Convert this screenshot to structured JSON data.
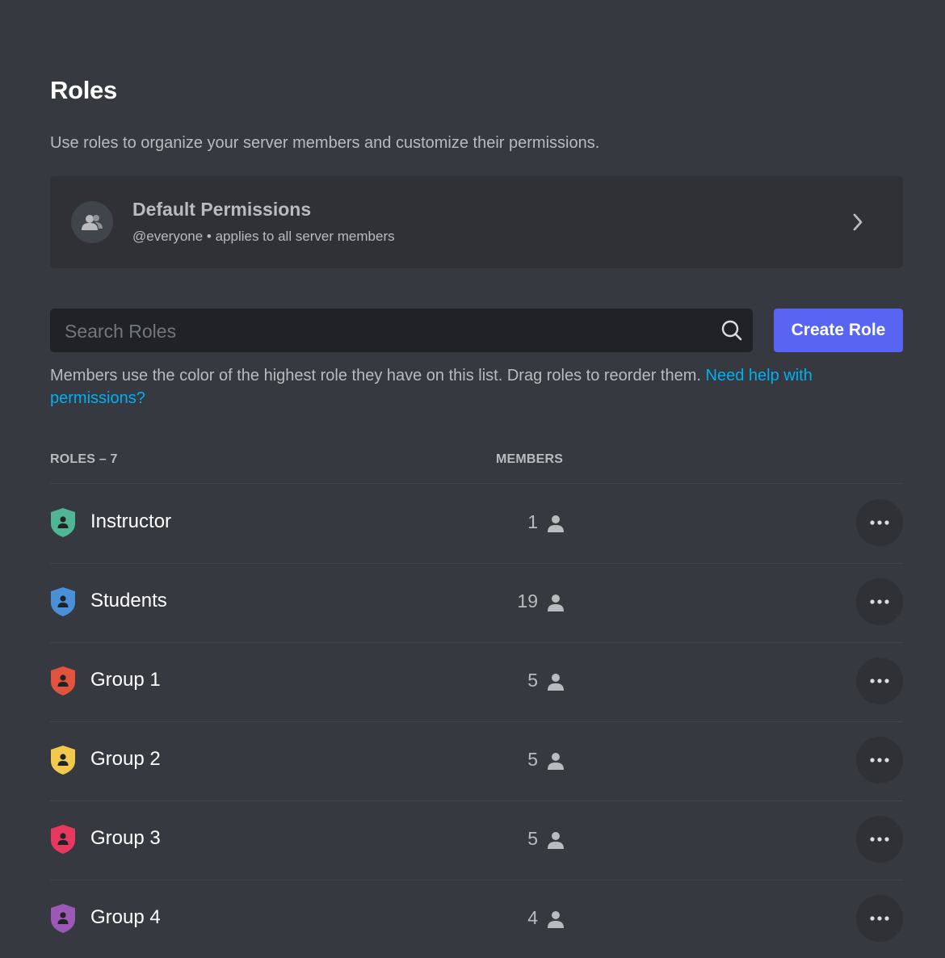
{
  "header": {
    "title": "Roles",
    "subtitle": "Use roles to organize your server members and customize their permissions."
  },
  "default_permissions": {
    "title": "Default Permissions",
    "subtitle": "@everyone • applies to all server members",
    "icon": "members-icon"
  },
  "search": {
    "placeholder": "Search Roles",
    "value": ""
  },
  "create_button": {
    "label": "Create Role",
    "color": "#5865f2"
  },
  "help": {
    "text": "Members use the color of the highest role they have on this list. Drag roles to reorder them.",
    "link": "Need help with permissions?"
  },
  "table": {
    "roles_header": "ROLES – 7",
    "members_header": "MEMBERS"
  },
  "roles": [
    {
      "name": "Instructor",
      "members": "1",
      "color": "#4fb594"
    },
    {
      "name": "Students",
      "members": "19",
      "color": "#4a90d9"
    },
    {
      "name": "Group 1",
      "members": "5",
      "color": "#e0533d"
    },
    {
      "name": "Group 2",
      "members": "5",
      "color": "#f2c94c"
    },
    {
      "name": "Group 3",
      "members": "5",
      "color": "#e9385f"
    },
    {
      "name": "Group 4",
      "members": "4",
      "color": "#9b59b6"
    }
  ]
}
